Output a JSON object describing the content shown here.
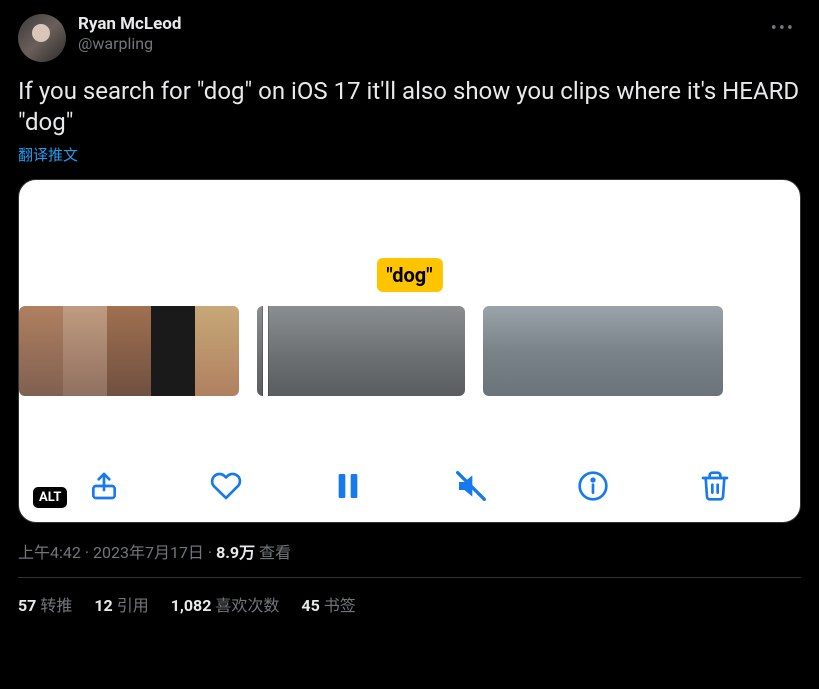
{
  "author": {
    "display_name": "Ryan McLeod",
    "handle": "@warpling"
  },
  "tweet_text": "If you search for \"dog\" on iOS 17 it'll also show you clips where it's HEARD \"dog\"",
  "translate_label": "翻译推文",
  "media": {
    "tooltip": "\"dog\"",
    "alt_badge": "ALT"
  },
  "meta": {
    "time": "上午4:42",
    "date": "2023年7月17日",
    "views_number": "8.9万",
    "views_label": "查看",
    "separator": " · "
  },
  "stats": {
    "retweets": {
      "n": "57",
      "label": "转推"
    },
    "quotes": {
      "n": "12",
      "label": "引用"
    },
    "likes": {
      "n": "1,082",
      "label": "喜欢次数"
    },
    "bookmarks": {
      "n": "45",
      "label": "书签"
    }
  }
}
